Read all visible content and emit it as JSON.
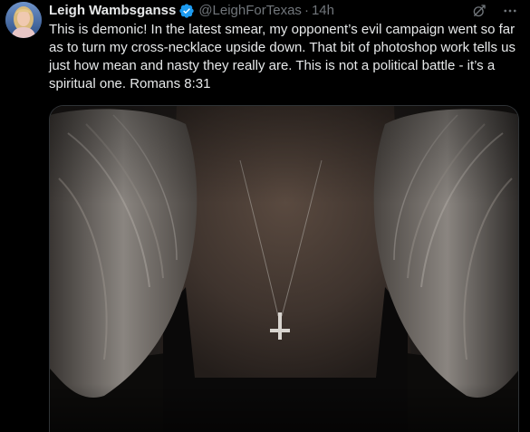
{
  "tweet": {
    "author": {
      "name": "Leigh Wambsganss",
      "handle": "@LeighForTexas",
      "verified": true,
      "avatar_icon": "profile-photo"
    },
    "separator": "·",
    "timestamp": "14h",
    "text": "This is demonic! In the latest smear, my opponent’s evil campaign went so far as to turn my cross-necklace upside down. That bit of photoshop work tells us just how mean and nasty they really are. This is not a political battle - it’s a spiritual one. Romans 8:31",
    "icons": {
      "grok": "grok-icon",
      "more": "more-options-icon",
      "verified": "verified-badge-icon"
    },
    "media": {
      "description_icon": "photo-upside-down-cross-necklace"
    }
  },
  "colors": {
    "background": "#000000",
    "text_primary": "#e7e9ea",
    "text_secondary": "#71767b",
    "verified_blue": "#1d9bf0",
    "border": "#2f3336"
  }
}
